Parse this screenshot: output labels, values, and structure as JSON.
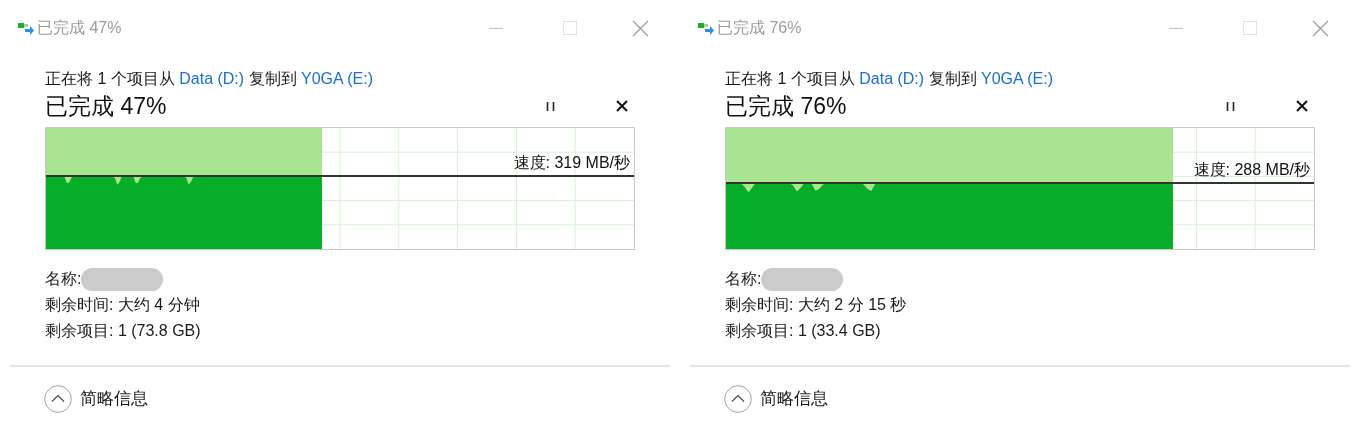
{
  "dialogs": [
    {
      "title": "已完成 47%",
      "copy_prefix": "正在将 1 个项目从 ",
      "source": "Data (D:)",
      "copy_middle": " 复制到 ",
      "destination": "Y0GA (E:)",
      "heading": "已完成 47%",
      "level": 0.47,
      "speed": "速度: 319 MB/秒",
      "name_label": "名称:",
      "time_left": "剩余时间: 大约 4 分钟",
      "items_left": "剩余项目: 1 (73.8 GB)",
      "details_toggle": "简略信息"
    },
    {
      "title": "已完成 76%",
      "copy_prefix": "正在将 1 个项目从 ",
      "source": "Data (D:)",
      "copy_middle": " 复制到 ",
      "destination": "Y0GA (E:)",
      "heading": "已完成 76%",
      "level": 0.76,
      "speed": "速度: 288 MB/秒",
      "name_label": "名称:",
      "time_left": "剩余时间: 大约 2 分 15 秒",
      "items_left": "剩余项目: 1 (33.4 GB)",
      "details_toggle": "简略信息"
    }
  ]
}
